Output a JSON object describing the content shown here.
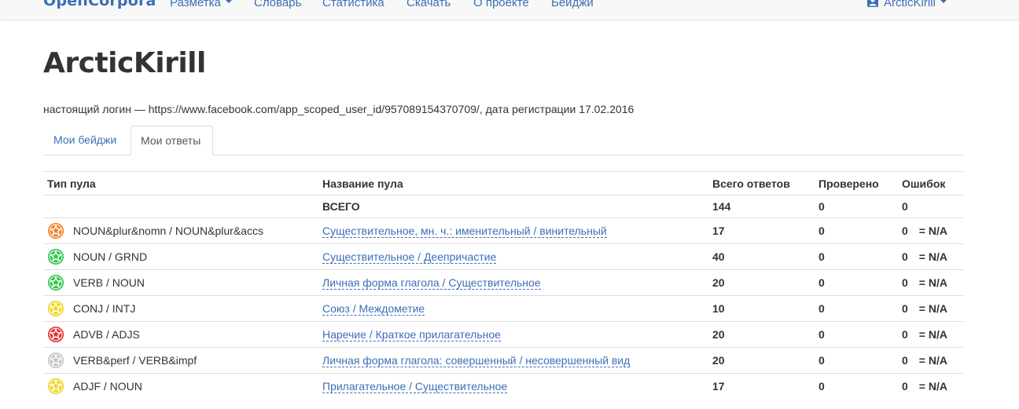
{
  "navbar": {
    "brand": "OpenCorpora",
    "items": [
      {
        "label": "Разметка",
        "dropdown": true
      },
      {
        "label": "Словарь"
      },
      {
        "label": "Статистика"
      },
      {
        "label": "Скачать"
      },
      {
        "label": "О проекте"
      },
      {
        "label": "Бейджи"
      }
    ],
    "user": "ArcticKirill"
  },
  "page": {
    "title": "ArcticKirill",
    "login_info": "настоящий логин — https://www.facebook.com/app_scoped_user_id/957089154370709/, дата регистрации 17.02.2016"
  },
  "tabs": [
    {
      "label": "Мои бейджи",
      "active": false
    },
    {
      "label": "Мои ответы",
      "active": true
    }
  ],
  "table": {
    "headers": [
      "Тип пула",
      "Название пула",
      "Всего ответов",
      "Проверено",
      "Ошибок"
    ],
    "total": {
      "name": "ВСЕГО",
      "answers": "144",
      "checked": "0",
      "errors": "0"
    },
    "rows": [
      {
        "type": "NOUN&plur&nomn / NOUN&plur&accs",
        "name": "Существительное, мн. ч.: именительный / винительный",
        "answers": "17",
        "checked": "0",
        "errors": "0",
        "ratio": "= N/A",
        "star_color": "#f07d26"
      },
      {
        "type": "NOUN / GRND",
        "name": "Существительное / Деепричастие",
        "answers": "40",
        "checked": "0",
        "errors": "0",
        "ratio": "= N/A",
        "star_color": "#2ec44a"
      },
      {
        "type": "VERB / NOUN",
        "name": "Личная форма глагола / Существительное",
        "answers": "20",
        "checked": "0",
        "errors": "0",
        "ratio": "= N/A",
        "star_color": "#2ec44a"
      },
      {
        "type": "CONJ / INTJ",
        "name": "Союз / Междометие",
        "answers": "10",
        "checked": "0",
        "errors": "0",
        "ratio": "= N/A",
        "star_color": "#f2d41b"
      },
      {
        "type": "ADVB / ADJS",
        "name": "Наречие / Краткое прилагательное",
        "answers": "20",
        "checked": "0",
        "errors": "0",
        "ratio": "= N/A",
        "star_color": "#e62e2e"
      },
      {
        "type": "VERB&perf / VERB&impf",
        "name": "Личная форма глагола: совершенный / несовершенный вид",
        "answers": "20",
        "checked": "0",
        "errors": "0",
        "ratio": "= N/A",
        "star_color": "#c4c4c4"
      },
      {
        "type": "ADJF / NOUN",
        "name": "Прилагательное / Существительное",
        "answers": "17",
        "checked": "0",
        "errors": "0",
        "ratio": "= N/A",
        "star_color": "#f2d41b"
      }
    ]
  }
}
